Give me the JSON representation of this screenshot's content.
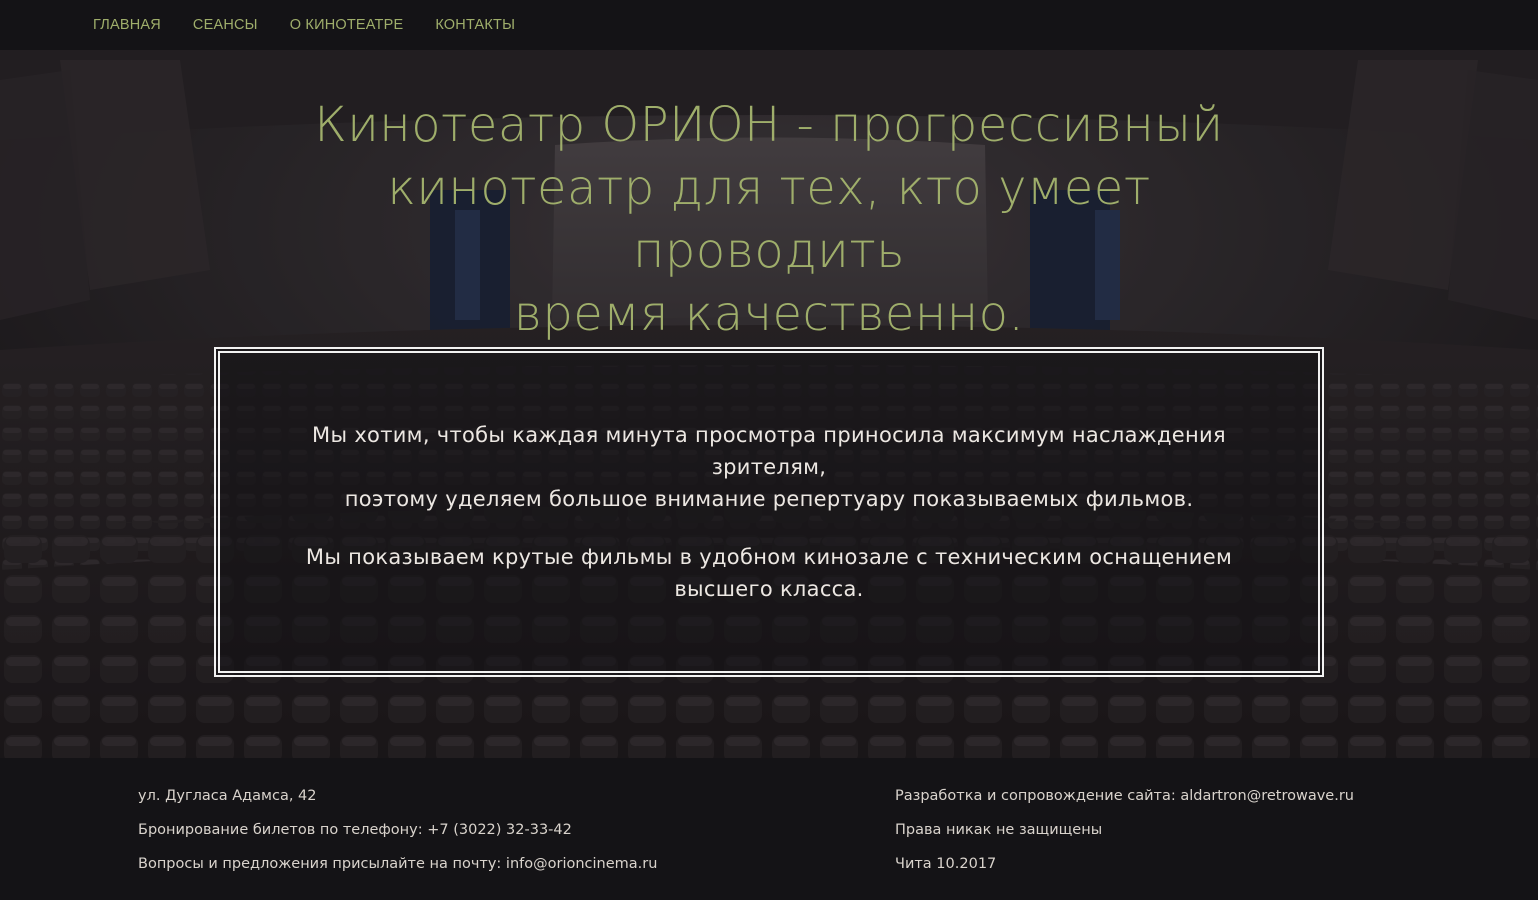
{
  "nav": {
    "items": [
      {
        "label": "ГЛАВНАЯ"
      },
      {
        "label": "СЕАНСЫ"
      },
      {
        "label": "О КИНОТЕАТРЕ"
      },
      {
        "label": "КОНТАКТЫ"
      }
    ]
  },
  "hero": {
    "headline_lines": [
      "Кинотеатр ОРИОН - прогрессивный",
      "кинотеатр для тех, кто умеет проводить",
      "время качественно."
    ]
  },
  "about": {
    "paragraph1_line1": "Мы хотим, чтобы каждая минута просмотра приносила максимум наслаждения зрителям,",
    "paragraph1_line2": "поэтому уделяем большое внимание репертуару показываемых фильмов.",
    "paragraph2": "Мы показываем крутые фильмы в удобном кинозале с техническим оснащением высшего класса."
  },
  "footer": {
    "address": "ул. Дугласа Адамса, 42",
    "booking": "Бронирование билетов по телефону: +7 (3022) 32-33-42",
    "questions": "Вопросы и предложения присылайте на почту: info@orioncinema.ru",
    "development": "Разработка и сопровождение сайта: aldartron@retrowave.ru",
    "rights": "Права никак не защищены",
    "city_date": "Чита 10.2017"
  },
  "colors": {
    "accent": "#9fae6b",
    "background": "#141316",
    "text_light": "#ece7e2"
  }
}
